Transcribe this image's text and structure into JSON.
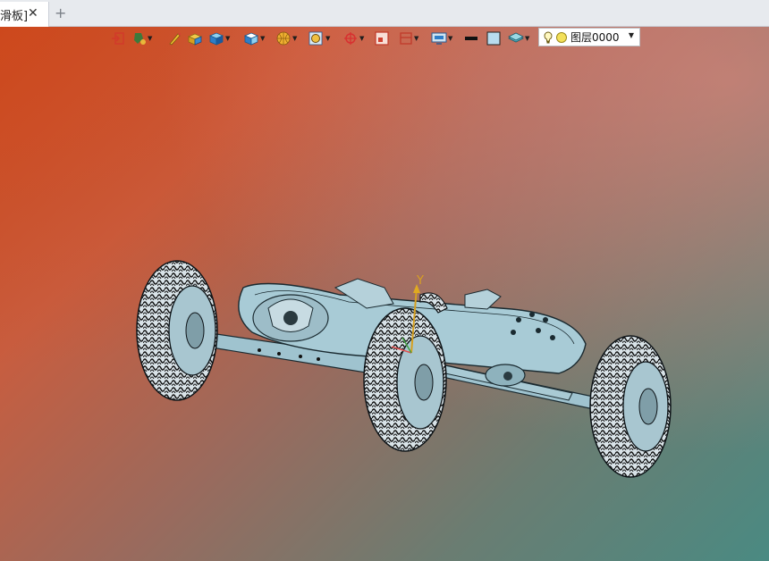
{
  "tabs": [
    {
      "title": "滑板]",
      "active": true
    }
  ],
  "tab_add_symbol": "+",
  "tab_close_symbol": "✕",
  "toolbar": {
    "icons": [
      "import-icon",
      "paint-icon",
      "pen-icon",
      "block-icon",
      "box-icon",
      "view-cube-icon",
      "sphere-icon",
      "zoom-icon",
      "rotate-icon",
      "rect-icon",
      "section-icon",
      "display-icon",
      "line-weight-icon",
      "color-swatch-icon",
      "layer-stack-icon"
    ],
    "layer": {
      "label": "图层0000",
      "bulb_icon": "light-bulb-icon",
      "color": "#f3e05a"
    }
  },
  "viewport": {
    "axis_label": "Y",
    "background_top_left": "#c94a1f",
    "background_top_right": "#ec857a",
    "background_bottom_right": "#4a8a82",
    "model_color": "#9fc3cf"
  }
}
